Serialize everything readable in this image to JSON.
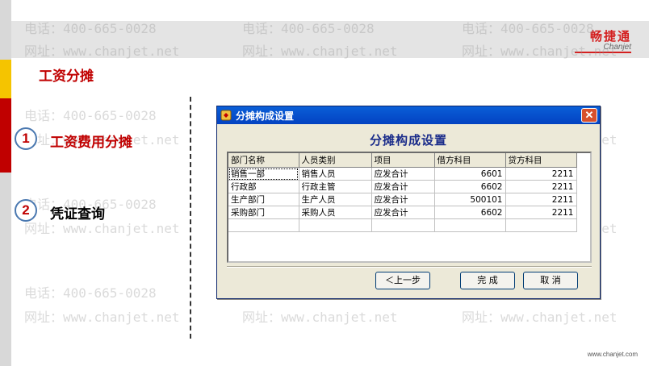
{
  "brand": {
    "name_cn": "畅捷通",
    "name_en": "Chanjet"
  },
  "section_title": "工资分摊",
  "nav": [
    {
      "num": "1",
      "label": "工资费用分摊"
    },
    {
      "num": "2",
      "label": "凭证查询"
    }
  ],
  "watermark": {
    "phone": "电话：400-665-0028",
    "site": "网址：www.chanjet.net"
  },
  "footer_url": "www.chanjet.com",
  "dialog": {
    "title": "分摊构成设置",
    "heading": "分摊构成设置",
    "columns": [
      "部门名称",
      "人员类别",
      "项目",
      "借方科目",
      "贷方科目"
    ],
    "rows": [
      [
        "销售一部",
        "销售人员",
        "应发合计",
        "6601",
        "2211"
      ],
      [
        "行政部",
        "行政主管",
        "应发合计",
        "6602",
        "2211"
      ],
      [
        "生产部门",
        "生产人员",
        "应发合计",
        "500101",
        "2211"
      ],
      [
        "采购部门",
        "采购人员",
        "应发合计",
        "6602",
        "2211"
      ]
    ],
    "buttons": {
      "prev": "＜上一步",
      "finish": "完 成",
      "cancel": "取 消"
    }
  },
  "colors": {
    "accent_red": "#c00000",
    "title_blue": "#1a2c8a",
    "titlebar": "#0a5fd8"
  }
}
